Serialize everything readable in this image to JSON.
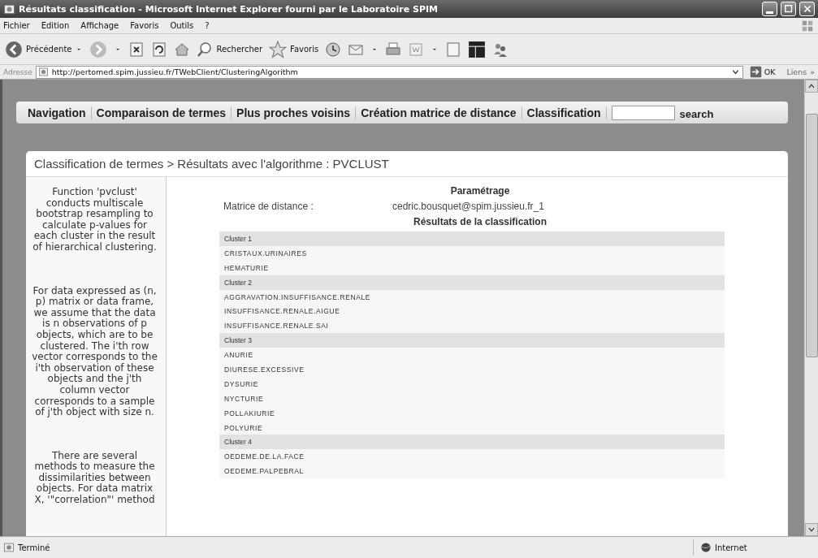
{
  "window": {
    "title": "Résultats classification - Microsoft Internet Explorer fourni par le Laboratoire SPIM"
  },
  "menu": [
    "Fichier",
    "Edition",
    "Affichage",
    "Favoris",
    "Outils",
    "?"
  ],
  "toolbar": {
    "back": "Précédente",
    "search": "Rechercher",
    "favorites": "Favoris"
  },
  "address": {
    "label": "Adresse",
    "url": "http://pertomed.spim.jussieu.fr/TWebClient/ClusteringAlgorithm",
    "go": "OK",
    "links": "Liens",
    "more": "»"
  },
  "nav": {
    "items": [
      "Navigation",
      "Comparaison de termes",
      "Plus proches voisins",
      "Création matrice de distance",
      "Classification"
    ],
    "search_button": "search"
  },
  "breadcrumb": "Classification de termes > Résultats avec l'algorithme : PVCLUST",
  "sidebar": [
    "Function 'pvclust' conducts multiscale bootstrap resampling to calculate p-values for each cluster in the result of hierarchical clustering.",
    "For data expressed as (n, p) matrix or data frame, we assume that the data is n observations of p objects, which are to be clustered. The i'th row vector corresponds to the i'th observation of these objects and the j'th column vector corresponds to a sample of j'th object with size n.",
    "There are several methods to measure the dissimilarities between objects. For data matrix X, '\"correlation\"' method"
  ],
  "params": {
    "heading": "Paramétrage",
    "label": "Matrice de distance :",
    "value": "cedric.bousquet@spim.jussieu.fr_1"
  },
  "results": {
    "heading": "Résultats de la classification",
    "clusters": [
      {
        "name": "Cluster 1",
        "items": [
          "CRISTAUX.URINAIRES",
          "HEMATURIE"
        ]
      },
      {
        "name": "Cluster 2",
        "items": [
          "AGGRAVATION.INSUFFISANCE.RENALE",
          "INSUFFISANCE.RENALE.AIGUE",
          "INSUFFISANCE.RENALE.SAI"
        ]
      },
      {
        "name": "Cluster 3",
        "items": [
          "ANURIE",
          "DIURESE.EXCESSIVE",
          "DYSURIE",
          "NYCTURIE",
          "POLLAKIURIE",
          "POLYURIE"
        ]
      },
      {
        "name": "Cluster 4",
        "items": [
          "OEDEME.DE.LA.FACE",
          "OEDEME.PALPEBRAL"
        ]
      }
    ]
  },
  "status": {
    "text": "Terminé",
    "zone": "Internet"
  }
}
